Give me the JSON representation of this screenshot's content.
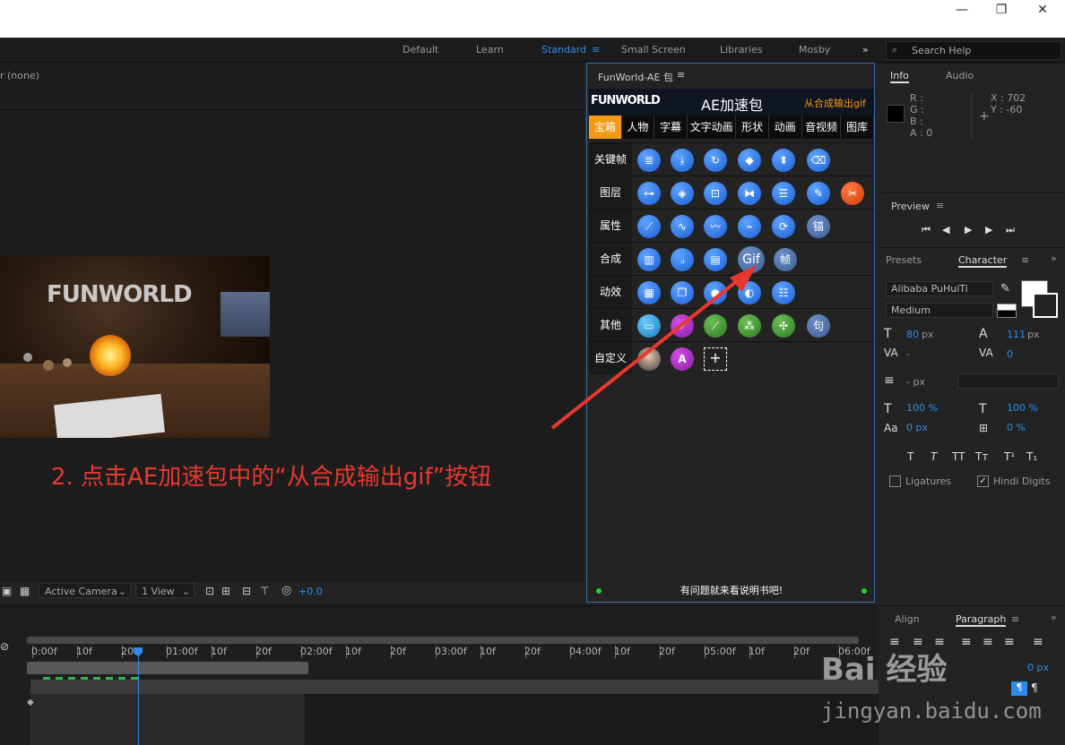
{
  "window": {
    "minimize": "—",
    "restore": "❐",
    "close": "✕"
  },
  "workspaces": [
    "Default",
    "Learn",
    "Standard",
    "Small Screen",
    "Libraries",
    "Mosby"
  ],
  "workspace_active": "Standard",
  "search": {
    "placeholder": "Search Help"
  },
  "comp": {
    "label": "r  (none)",
    "zoom_select": "Active Camera",
    "view_select": "1 View",
    "exposure": "+0.0",
    "scene_text": "FUNWORLD"
  },
  "plugin": {
    "title": "FunWorld-AE 包",
    "brand": "FUNWORLD",
    "name": "AE加速包",
    "slogan": "从合成输出gif",
    "tabs": [
      "宝箱",
      "人物",
      "字幕",
      "文字动画",
      "形状",
      "动画",
      "音视频",
      "图库"
    ],
    "rows": [
      {
        "label": "关键帧"
      },
      {
        "label": "图层"
      },
      {
        "label": "属性"
      },
      {
        "label": "合成"
      },
      {
        "label": "动效"
      },
      {
        "label": "其他"
      },
      {
        "label": "自定义"
      }
    ],
    "gif_button": "Gif",
    "frame_button": "帧",
    "anchor_button": "锚",
    "clip_button": "句",
    "custom_letter": "A",
    "add": "+",
    "footer": "有问题就来看说明书吧!"
  },
  "info": {
    "tab_info": "Info",
    "tab_audio": "Audio",
    "r": "R :",
    "g": "G :",
    "b": "B :",
    "a": "A : 0",
    "x": "X : 702",
    "y": "Y : -60"
  },
  "preview": {
    "title": "Preview"
  },
  "character": {
    "tab_presets": "Presets",
    "tab_character": "Character",
    "font": "Alibaba PuHuiTi",
    "style": "Medium",
    "size": "80",
    "size_unit": "px",
    "leading": "111",
    "leading_unit": "px",
    "kerning": "-",
    "tracking": "0",
    "stroke": "- px",
    "vscale": "100 %",
    "hscale": "100 %",
    "baseline": "0 px",
    "tsume": "0 %",
    "ligatures": "Ligatures",
    "hindi": "Hindi Digits"
  },
  "align": {
    "tab_align": "Align",
    "tab_paragraph": "Paragraph",
    "indent": "0 px"
  },
  "timeline": {
    "ticks": [
      "0:00f",
      "10f",
      "20f",
      "01:00f",
      "10f",
      "20f",
      "02:00f",
      "10f",
      "20f",
      "03:00f",
      "10f",
      "20f",
      "04:00f",
      "10f",
      "20f",
      "05:00f",
      "10f",
      "20f",
      "06:00f"
    ]
  },
  "annotation": "2. 点击AE加速包中的“从合成输出gif”按钮",
  "watermark": {
    "main": "Bai 经验",
    "sub": "jingyan.baidu.com"
  },
  "colors": {
    "accent": "#2d8ceb",
    "orange": "#f29a13",
    "annotation": "#e8382e"
  }
}
